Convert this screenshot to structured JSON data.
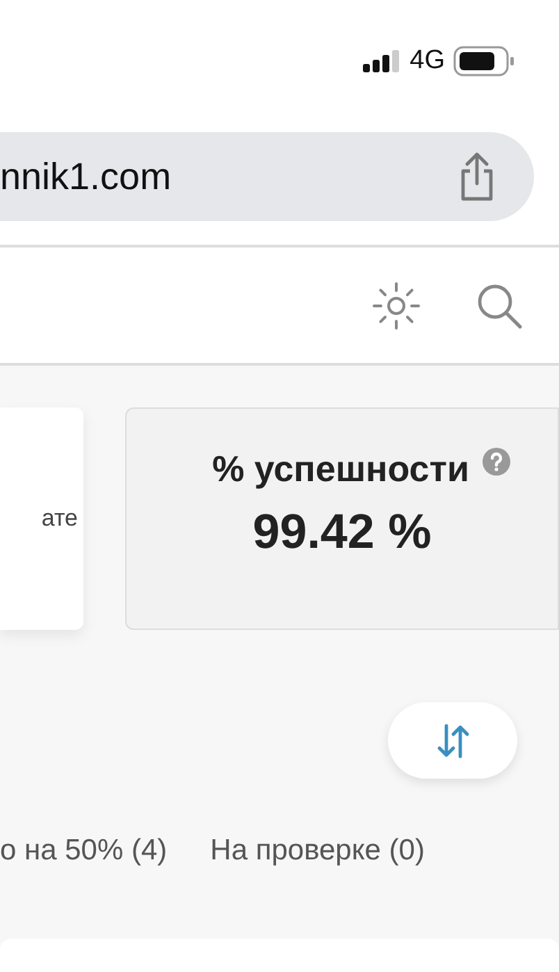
{
  "status_bar": {
    "network": "4G"
  },
  "address_bar": {
    "url": "nnik1.com"
  },
  "cards": [
    {
      "kind": "plain",
      "text": "ате"
    },
    {
      "kind": "stat",
      "title": "% успешности",
      "value": "99.42 %"
    }
  ],
  "tabs": [
    {
      "label": "о на 50% (4)",
      "selected": false
    },
    {
      "label": "На проверке (0)",
      "selected": false
    }
  ]
}
